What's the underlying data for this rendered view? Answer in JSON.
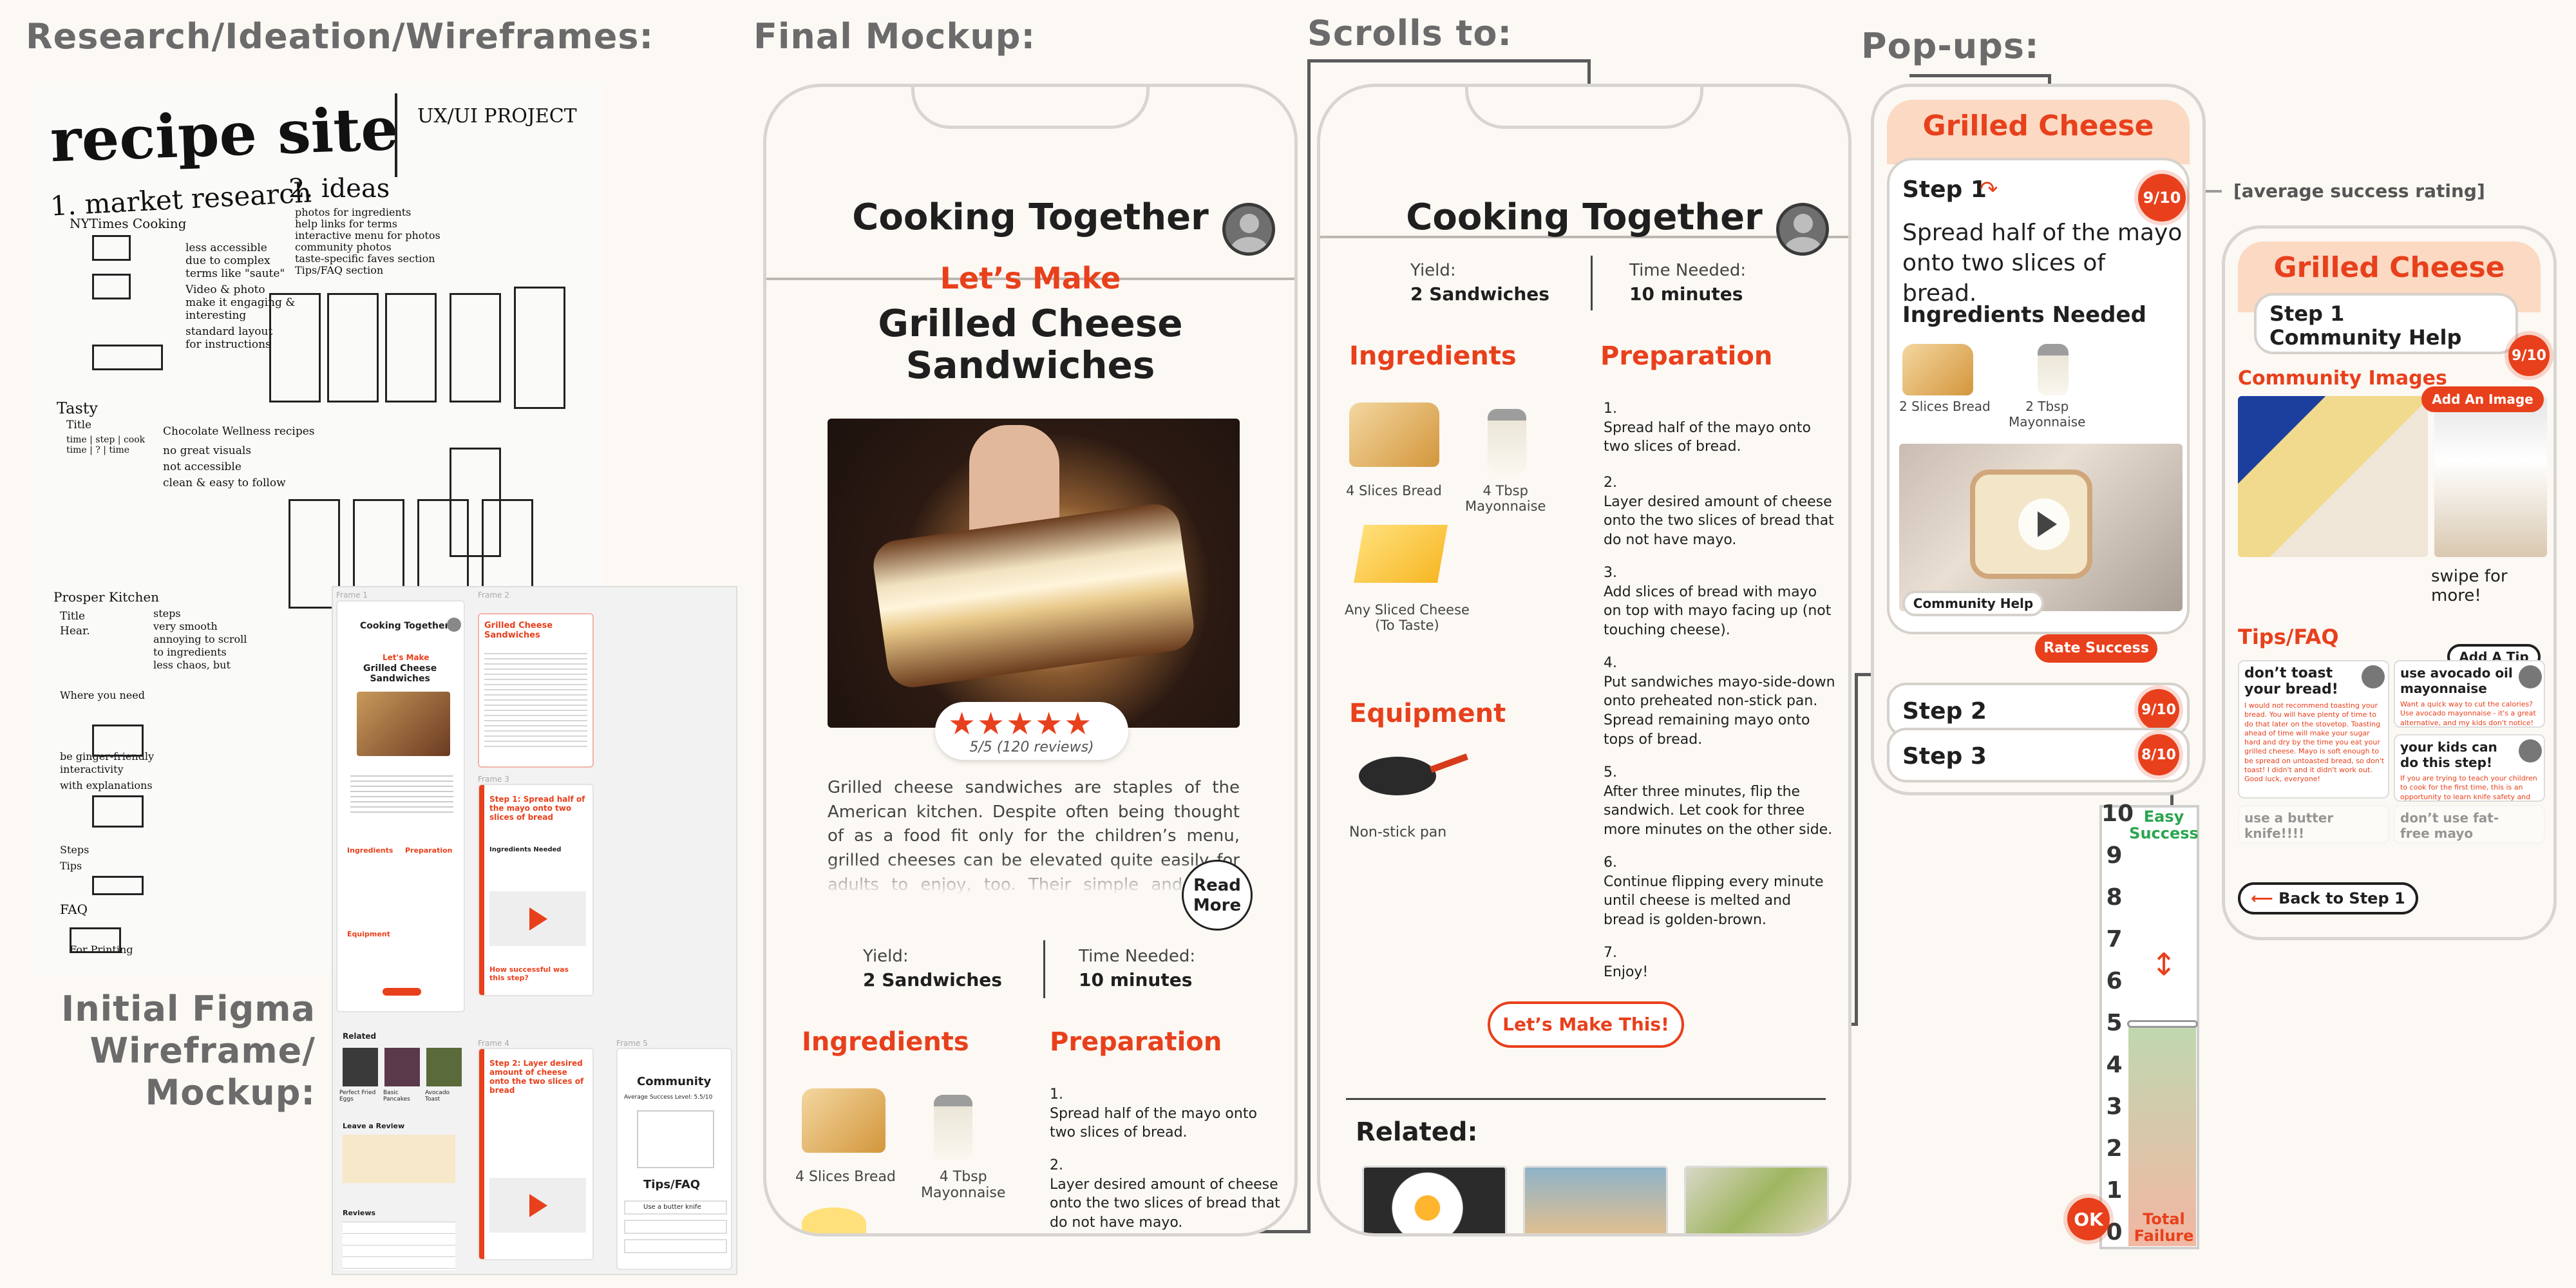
{
  "headings": {
    "research": "Research/Ideation/Wireframes:",
    "final_mockup": "Final Mockup:",
    "scrolls_to": "Scrolls to:",
    "popups": "Pop-ups:",
    "initial_figma": "Initial Figma\nWireframe/\nMockup:"
  },
  "sketch": {
    "title": "recipe site",
    "project": "UX/UI PROJECT",
    "col1": "1. market research",
    "col2": "2. ideas",
    "notes": [
      "NYTimes Cooking",
      "less accessible",
      "due to complex",
      "terms like \"saute\"",
      "Video & photo",
      "make it engaging &",
      "interesting",
      "standard layout",
      "for instructions",
      "photos for ingredients",
      "help links for terms",
      "interactive menu for photos",
      "community photos",
      "taste-specific faves section",
      "Tips/FAQ section",
      "Tasty",
      "Title",
      "time | step | cook",
      "time | ? | time",
      "Chocolate Wellness recipes",
      "no great visuals",
      "not accessible",
      "clean & easy to follow",
      "Prosper Kitchen",
      "Title",
      "Hear.",
      "Where you need",
      "steps",
      "very smooth",
      "annoying to scroll",
      "to ingredients",
      "less chaos, but",
      "be ginger-friendly",
      "interactivity",
      "with explanations",
      "Steps",
      "FAQ",
      "Tips",
      "For Printing"
    ]
  },
  "phone1": {
    "title": "Cooking Together",
    "lets_make": "Let’s Make",
    "dish": "Grilled Cheese\nSandwiches",
    "rating": "5/5 (120 reviews)",
    "description": "Grilled cheese sandwiches are staples of the American kitchen. Despite often being thought of as a food fit only for the children’s menu, grilled cheeses can be elevated quite easily for adults to enjoy, too. Their simple and quick preparation is perfect for any meal.",
    "read_more": "Read\nMore",
    "yield_label": "Yield:",
    "yield_value": "2 Sandwiches",
    "time_label": "Time Needed:",
    "time_value": "10 minutes",
    "ingredients": "Ingredients",
    "preparation": "Preparation",
    "ing1": "4 Slices Bread",
    "ing2": "4 Tbsp\nMayonnaise",
    "step1": "1.\nSpread half of the mayo onto two slices of bread.",
    "step2": "2.\nLayer desired amount of cheese onto the two slices of bread that do not have mayo."
  },
  "phone2": {
    "title": "Cooking Together",
    "yield_label": "Yield:",
    "yield_value": "2 Sandwiches",
    "time_label": "Time Needed:",
    "time_value": "10 minutes",
    "ingredients": "Ingredients",
    "preparation": "Preparation",
    "ing1": "4 Slices Bread",
    "ing2": "4 Tbsp\nMayonnaise",
    "ing3": "Any Sliced Cheese\n(To Taste)",
    "equipment": "Equipment",
    "eq1": "Non-stick pan",
    "steps": [
      "1.\nSpread half of the mayo onto two slices of bread.",
      "2.\nLayer desired amount of cheese onto the two slices of bread that do not have mayo.",
      "3.\nAdd slices of bread with mayo on top with mayo facing up (not touching cheese).",
      "4.\nPut sandwiches mayo-side-down onto preheated non-stick pan. Spread remaining mayo onto tops of bread.",
      "5.\nAfter three minutes, flip the sandwich. Let cook for three more minutes on the other side.",
      "6.\nContinue flipping every minute until cheese is melted and bread is golden-brown.",
      "7.\nEnjoy!"
    ],
    "cta": "Let’s Make This!",
    "related": "Related:"
  },
  "popup1": {
    "title": "Grilled Cheese",
    "step": "Step 1",
    "rating": "9/10",
    "instruction": "Spread half of the mayo onto two slices of bread.",
    "ing_needed": "Ingredients Needed",
    "ing1": "2 Slices Bread",
    "ing2": "2 Tbsp\nMayonnaise",
    "community_help": "Community Help",
    "rate_success": "Rate Success",
    "step2": "Step 2",
    "step2_rating": "9/10",
    "step3": "Step 3",
    "step3_rating": "8/10",
    "avg_note": "[average success rating]"
  },
  "popup2": {
    "title": "Grilled Cheese",
    "subtitle": "Step 1\nCommunity Help",
    "rating": "9/10",
    "community_images": "Community Images",
    "add_image": "Add An Image",
    "swipe": "swipe for more!",
    "tips": "Tips/FAQ",
    "add_tip": "Add A Tip",
    "tip1_title": "don’t toast your bread!",
    "tip1_body": "I would not recommend toasting your bread. You will have plenty of time to do that later on the stovetop. Toasting ahead of time will make your sugar hard and dry by the time you eat your grilled cheese. Mayo is soft enough to be spread on untoasted bread, so don't toast! I didn't and it didn't work out. Good luck, everyone!",
    "tip2_title": "use avocado oil mayonnaise",
    "tip2_body": "Want a quick way to cut the calories? Use avocado mayonnaise - it's a great alternative, and my kids don't notice!",
    "tip3_title": "your kids can do this step!",
    "tip3_body": "If you are trying to teach your children to cook for the first time, this is an opportunity to learn knife safety and fine motor skills",
    "tip4_title": "use a butter knife!!!!",
    "tip5_title": "don’t use fat-free mayo",
    "back": "Back to Step 1"
  },
  "slider": {
    "top_label": "Easy\nSuccess",
    "bottom_label": "Total\nFailure",
    "ok": "OK",
    "value": 5,
    "max": 10,
    "numbers": [
      "10",
      "9",
      "8",
      "7",
      "6",
      "5",
      "4",
      "3",
      "2",
      "1",
      "0"
    ]
  },
  "figma": {
    "frame1": "Frame 1",
    "frame2": "Frame 2",
    "frame3": "Frame 3",
    "frame4": "Frame 4",
    "frame5": "Frame 5",
    "app_title": "Cooking Together",
    "lets_make": "Let's Make",
    "dish": "Grilled Cheese\nSandwiches",
    "popup_title": "Grilled Cheese\nSandwiches",
    "step1": "Step 1: Spread half of the mayo onto two slices of bread",
    "step2": "Step 2: Layer desired amount of cheese onto the two slices of bread",
    "ing_needed": "Ingredients Needed",
    "how_successful": "How successful was this step?",
    "community": "Community",
    "avg_success": "Average Success Level: 5.5/10",
    "tips": "Tips/FAQ",
    "butter": "Use a butter knife",
    "related": "Related",
    "leave_review": "Leave a Review",
    "reviews": "Reviews",
    "ingredients": "Ingredients",
    "preparation": "Preparation",
    "equipment": "Equipment",
    "related_items": [
      "Perfect Fried Eggs",
      "Basic Pancakes",
      "Avocado Toast"
    ]
  }
}
